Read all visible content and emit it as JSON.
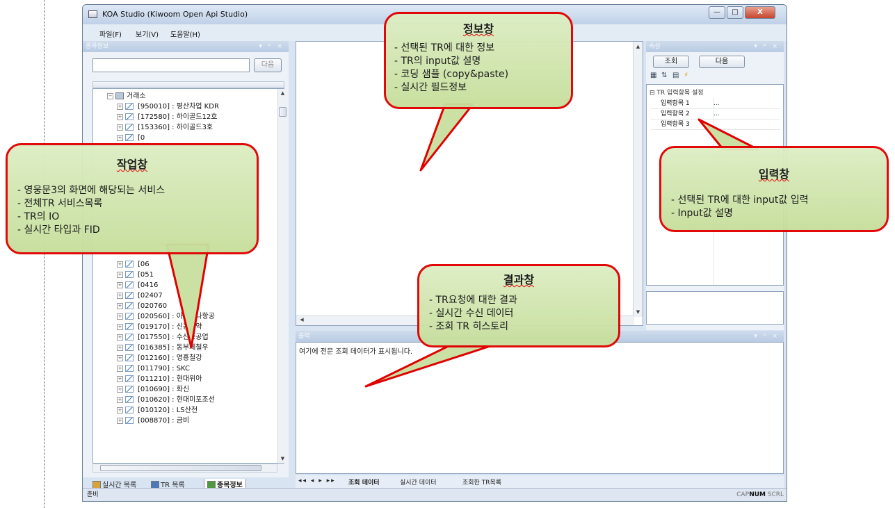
{
  "window": {
    "title": "KOA Studio (Kiwoom Open Api Studio)",
    "controls": {
      "minimize": "—",
      "maximize": "□",
      "close": "X"
    }
  },
  "menu": [
    "파일(F)",
    "보기(V)",
    "도움말(H)"
  ],
  "left_panel": {
    "header": "종목정보",
    "header_controls": "▾ ᵖ ×",
    "search_value": "",
    "search_button": "다음",
    "root_label": "거래소",
    "items": [
      "[950010] : 평산차업 KDR",
      "[172580] : 하이골드12호",
      "[153360] : 하이골드3호",
      "[0",
      "[06",
      "[051",
      "[0416",
      "[02407",
      "[020760",
      "[020560] : 아시아나항공",
      "[019170] : 신풍제약",
      "[017550] : 수산중공업",
      "[016385] : 동부제철우",
      "[012160] : 영흥철강",
      "[011790] : SKC",
      "[011210] : 현대위아",
      "[010690] : 화신",
      "[010620] : 현대미포조선",
      "[010120] : LS산전",
      "[008870] : 금비"
    ],
    "bottom_tabs": [
      "실시간 목록",
      "TR 목록",
      "종목정보"
    ]
  },
  "property_panel": {
    "header": "속성",
    "header_controls": "▾ ᵖ ×",
    "query_button": "조회",
    "next_button": "다음",
    "category": "TR 입력항목 설정",
    "rows": [
      {
        "name": "입력항목 1",
        "value": "..."
      },
      {
        "name": "입력항목 2",
        "value": "..."
      },
      {
        "name": "입력항목 3",
        "value": ""
      }
    ]
  },
  "output_panel": {
    "header": "출력",
    "header_controls": "▾ ᵖ ×",
    "message": "여기에 전문 조회 데이터가 표시됩니다.",
    "nav": "◂◂ ◂ ▸ ▸▸",
    "tabs": [
      "조회 데이터",
      "실시간 데이터",
      "조회한 TR목록"
    ]
  },
  "status_bar": {
    "left": "준비",
    "indicators": [
      "CAP",
      "NUM",
      "SCRL"
    ]
  },
  "callouts": {
    "info": {
      "title": "정보창",
      "lines": [
        "- 선택된 TR에 대한 정보",
        "- TR의 input값 설명",
        "- 코딩 샘플 (copy&paste)",
        "- 실시간 필드정보"
      ]
    },
    "work": {
      "title": "작업창",
      "lines": [
        "- 영웅문3의 화면에 해당되는 서비스",
        "- 전체TR 서비스목록",
        "- TR의 IO",
        "- 실시간 타입과 FID"
      ]
    },
    "input": {
      "title": "입력창",
      "lines": [
        "- 선택된 TR에 대한 input값 입력",
        "- Input값 설명"
      ]
    },
    "result": {
      "title": "결과창",
      "lines": [
        "- TR요청에 대한 결과",
        "- 실시간 수신 데이터",
        "- 조회 TR 히스토리"
      ]
    }
  },
  "colors": {
    "callout_border": "#e00000",
    "callout_fill": "#d3e6b0",
    "pane_header": "#bccde3"
  }
}
